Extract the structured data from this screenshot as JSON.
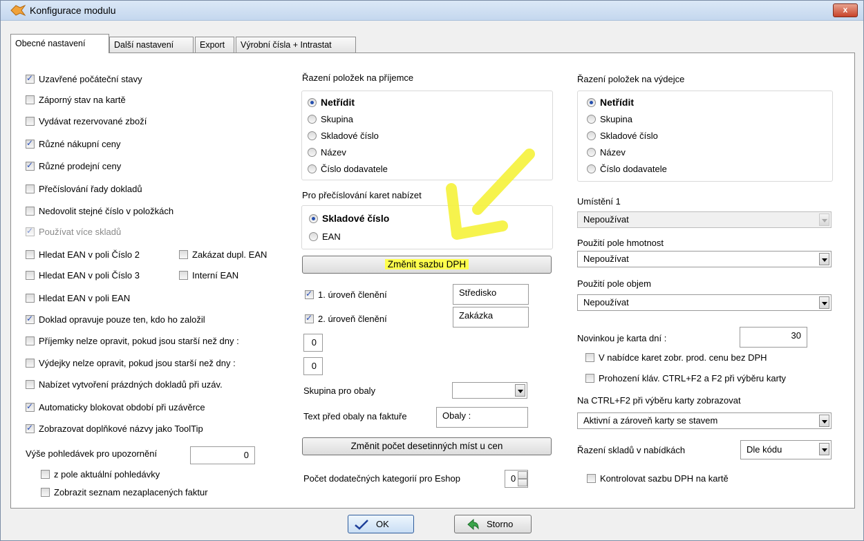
{
  "window": {
    "title": "Konfigurace modulu",
    "close_label": "x"
  },
  "tabs": [
    {
      "label": "Obecné nastavení",
      "active": true
    },
    {
      "label": "Další nastavení"
    },
    {
      "label": "Export"
    },
    {
      "label": "Výrobní čísla + Intrastat"
    }
  ],
  "left": {
    "checkboxes": [
      {
        "label": "Uzavřené počáteční stavy",
        "checked": true
      },
      {
        "label": "Záporný stav na kartě",
        "checked": false
      },
      {
        "label": "Vydávat rezervované zboží",
        "checked": false
      },
      {
        "label": "Různé nákupní  ceny",
        "checked": true
      },
      {
        "label": "Různé prodejní ceny",
        "checked": true
      },
      {
        "label": "Přečíslování řady dokladů",
        "checked": false
      },
      {
        "label": "Nedovolit stejné číslo v položkách",
        "checked": false
      },
      {
        "label": "Používat více skladů",
        "checked": true,
        "disabled": true
      },
      {
        "label": "Hledat EAN v poli Číslo 2",
        "checked": false
      },
      {
        "label": "Hledat EAN v poli Číslo 3",
        "checked": false
      },
      {
        "label": "Hledat EAN v poli EAN",
        "checked": false
      },
      {
        "label": "Doklad opravuje pouze ten, kdo ho založil",
        "checked": true
      },
      {
        "label": "Příjemky nelze opravit, pokud jsou starší než dny :",
        "checked": false
      },
      {
        "label": "Výdejky nelze opravit, pokud jsou starší než dny :",
        "checked": false
      },
      {
        "label": "Nabízet vytvoření prázdných dokladů při uzáv.",
        "checked": false
      },
      {
        "label": "Automaticky blokovat období při uzávěrce",
        "checked": true
      },
      {
        "label": "Zobrazovat doplňkové názvy jako ToolTip",
        "checked": true
      }
    ],
    "ean_extra": [
      {
        "label": "Zakázat dupl. EAN",
        "checked": false
      },
      {
        "label": "Interní EAN",
        "checked": false
      }
    ],
    "receivables_label": "Výše pohledávek pro upozornění",
    "receivables_value": "0",
    "sub_checkboxes": [
      {
        "label": "z pole aktuální pohledávky",
        "checked": false
      },
      {
        "label": "Zobrazit seznam nezaplacených faktur",
        "checked": false
      }
    ]
  },
  "middle": {
    "prijemce_title": "Řazení položek na příjemce",
    "prijemce_options": [
      "Netřídit",
      "Skupina",
      "Skladové číslo",
      "Název",
      "Číslo dodavatele"
    ],
    "preciselni_title": "Pro přečíslování karet nabízet",
    "preciselni_options": [
      "Skladové číslo",
      "EAN"
    ],
    "vat_button": "Změnit sazbu DPH",
    "level1_label": "1. úroveň členění",
    "level1_value": "Středisko",
    "level2_label": "2. úroveň členění",
    "level2_value": "Zakázka",
    "num1": "0",
    "num2": "0",
    "obaly_group_label": "Skupina pro obaly",
    "obaly_group_value": "",
    "obaly_text_label": "Text před obaly na faktuře",
    "obaly_text_value": "Obaly :",
    "decimals_button": "Změnit počet desetinných míst u cen",
    "eshop_label": "Počet dodatečných kategorií pro Eshop",
    "eshop_value": "0"
  },
  "right": {
    "vydejce_title": "Řazení položek na výdejce",
    "vydejce_options": [
      "Netřídit",
      "Skupina",
      "Skladové číslo",
      "Název",
      "Číslo dodavatele"
    ],
    "umisteni_label": "Umístění 1",
    "umisteni_value": "Nepoužívat",
    "hmotnost_label": "Použití pole hmotnost",
    "hmotnost_value": "Nepoužívat",
    "objem_label": "Použití pole objem",
    "objem_value": "Nepoužívat",
    "novinka_label": "Novinkou je karta dní :",
    "novinka_value": "30",
    "cb1": "V nabídce karet zobr. prod. cenu bez DPH",
    "cb2": "Prohození kláv. CTRL+F2 a F2 při výběru karty",
    "ctrlf2_label": "Na CTRL+F2 při výběru karty zobrazovat",
    "ctrlf2_value": "Aktivní a zároveň karty se stavem",
    "razeni_skladu_label": "Řazení skladů v nabídkách",
    "razeni_skladu_value": "Dle kódu",
    "cb3": "Kontrolovat sazbu DPH na kartě"
  },
  "footer": {
    "ok": "OK",
    "storno": "Storno"
  },
  "colors": {
    "highlight": "#ffff4d",
    "arrow": "#f5f23a"
  }
}
